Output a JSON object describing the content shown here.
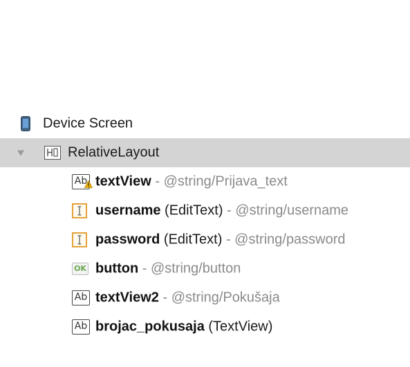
{
  "tree": {
    "root": {
      "label": "Device Screen",
      "icon": "device-screen-icon"
    },
    "layout": {
      "label": "RelativeLayout",
      "icon": "relative-layout-icon",
      "expanded": true,
      "selected": true
    },
    "children": [
      {
        "name": "textView",
        "type": "",
        "separator": " - ",
        "ref": "@string/Prijava_text",
        "icon": "textview-warning-icon"
      },
      {
        "name": "username",
        "type": " (EditText)",
        "separator": " - ",
        "ref": "@string/username",
        "icon": "edittext-icon"
      },
      {
        "name": "password",
        "type": " (EditText)",
        "separator": " - ",
        "ref": "@string/password",
        "icon": "edittext-icon"
      },
      {
        "name": "button",
        "type": "",
        "separator": " - ",
        "ref": "@string/button",
        "icon": "button-ok-icon"
      },
      {
        "name": "textView2",
        "type": "",
        "separator": " - ",
        "ref": "@string/Pokušaja",
        "icon": "textview-icon"
      },
      {
        "name": "brojac_pokusaja",
        "type": " (TextView)",
        "separator": "",
        "ref": "",
        "icon": "textview-icon"
      }
    ]
  },
  "icon_text": {
    "ab": "Ab",
    "ok": "OK"
  },
  "colors": {
    "selected_row": "#d4d4d4",
    "reference_text": "#8a8a8a",
    "edittext_icon": "#e5a23a",
    "warning": "#f0b400"
  }
}
